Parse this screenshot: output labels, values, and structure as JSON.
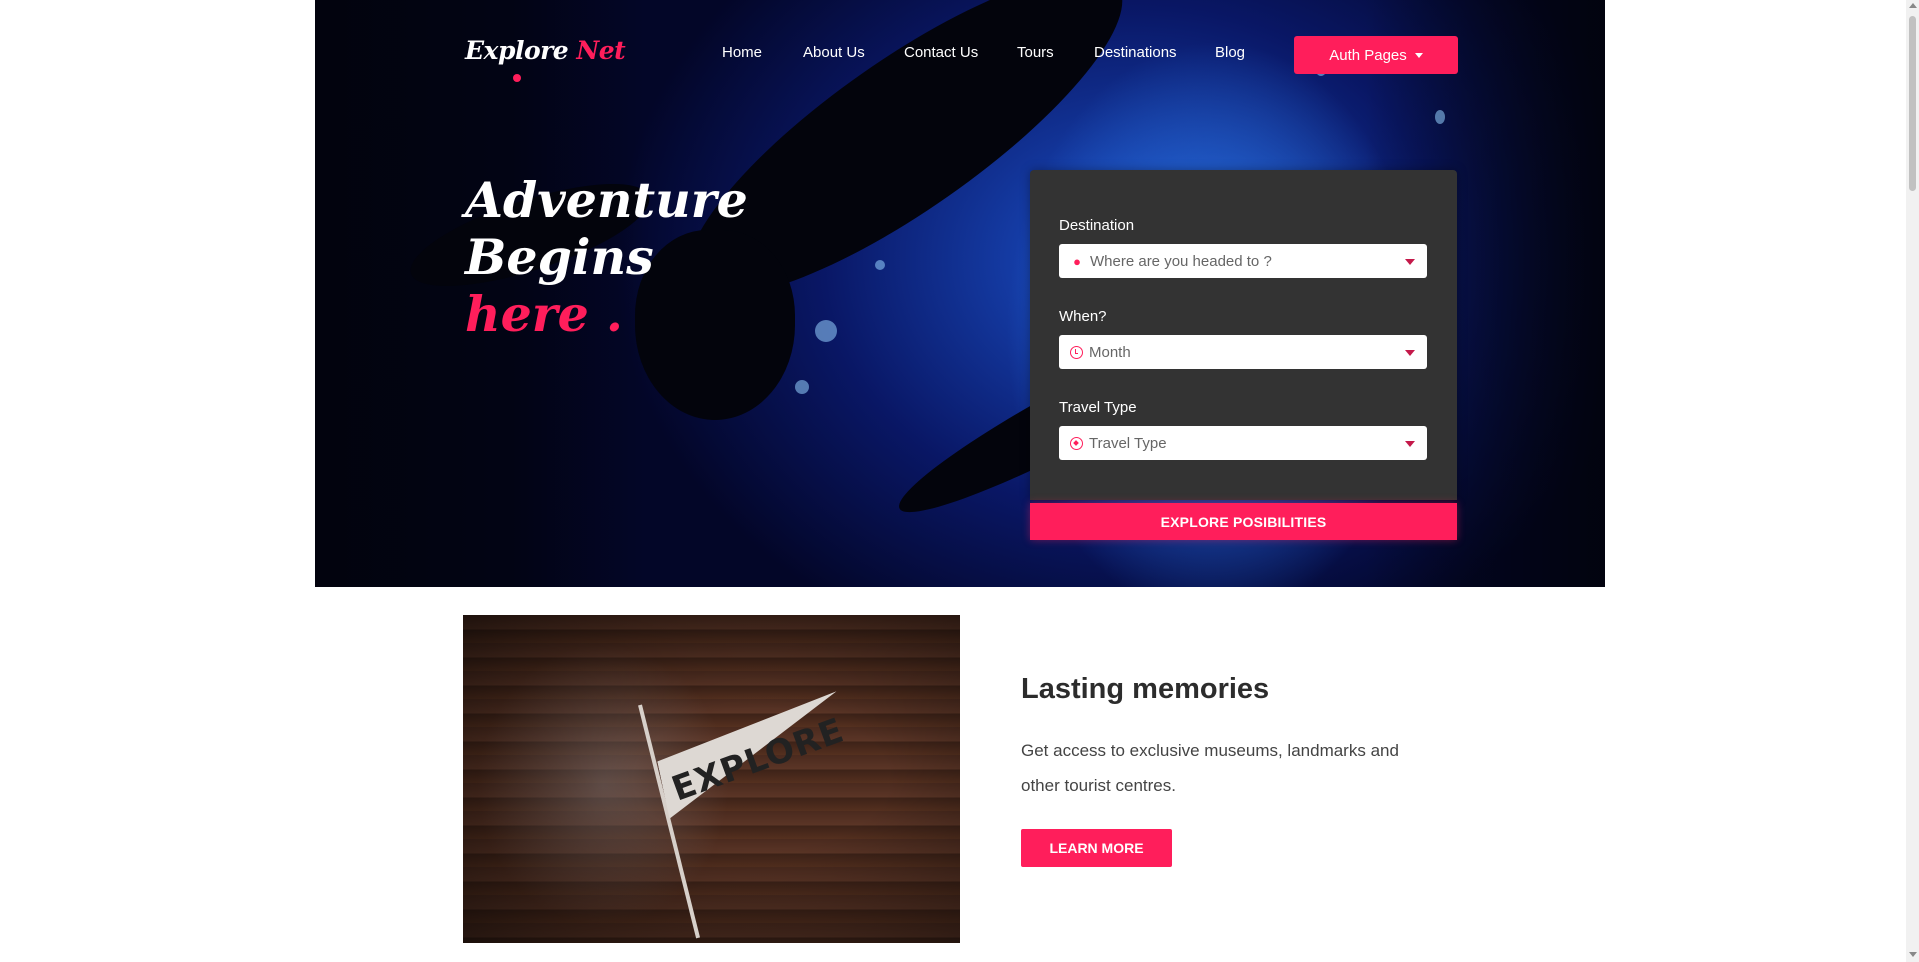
{
  "brand": {
    "name_main": "Explore",
    "name_accent": "Net",
    "accent_color": "#ff1e5b"
  },
  "nav": {
    "items": [
      {
        "label": "Home"
      },
      {
        "label": "About Us"
      },
      {
        "label": "Contact Us"
      },
      {
        "label": "Tours"
      },
      {
        "label": "Destinations"
      },
      {
        "label": "Blog"
      }
    ],
    "auth_label": "Auth Pages"
  },
  "hero": {
    "line1": "Adventure",
    "line2": "Begins",
    "line3": "here ."
  },
  "search": {
    "destination_label": "Destination",
    "destination_value": "Where are you headed to ?",
    "when_label": "When?",
    "when_value": "Month",
    "type_label": "Travel Type",
    "type_value": "Travel Type",
    "submit_label": "EXPLORE POSIBILITIES"
  },
  "feature": {
    "image_text": "EXPLORE",
    "title": "Lasting memories",
    "description": "Get access to exclusive museums, landmarks and other tourist centres.",
    "button_label": "LEARN MORE"
  }
}
